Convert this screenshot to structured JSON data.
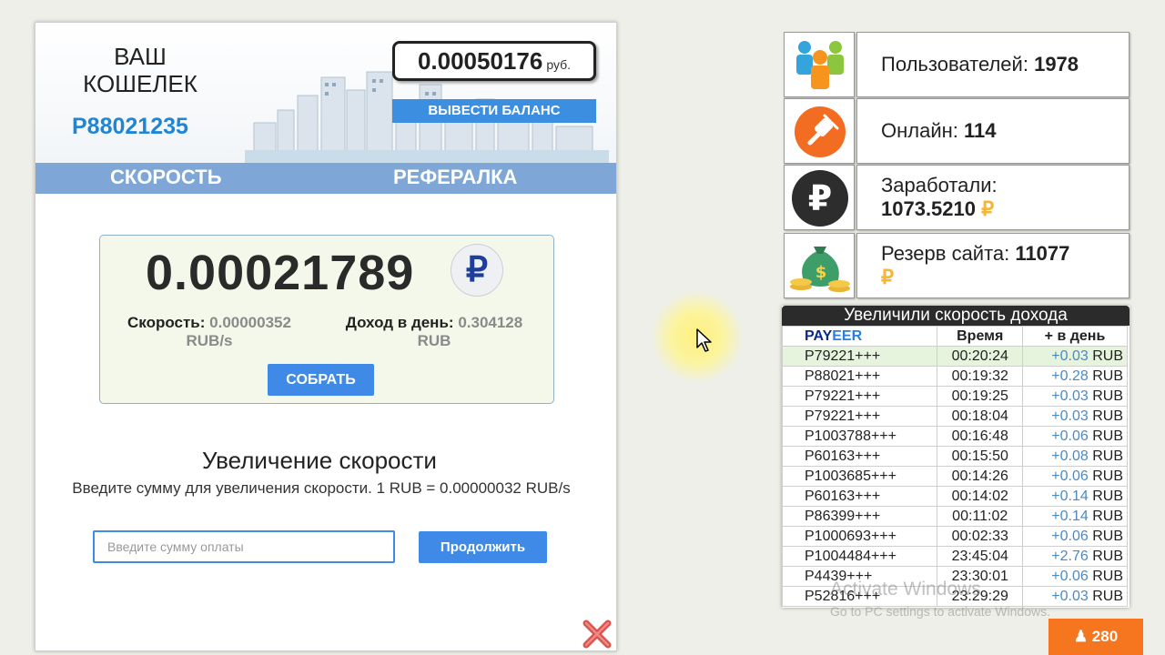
{
  "wallet": {
    "title": "ВАШ КОШЕЛЕК",
    "id": "P88021235",
    "balance": "0.00050176",
    "balance_unit": "руб.",
    "withdraw_label": "ВЫВЕСТИ БАЛАНС"
  },
  "nav": {
    "speed": "СКОРОСТЬ",
    "referral": "РЕФЕРАЛКА"
  },
  "mining": {
    "value": "0.00021789",
    "currency_symbol": "₽",
    "speed_label": "Скорость:",
    "speed_value": "0.00000352",
    "speed_unit": "RUB/s",
    "daily_label": "Доход в день:",
    "daily_value": "0.304128",
    "daily_unit": "RUB",
    "collect_label": "СОБРАТЬ"
  },
  "increase": {
    "title": "Увеличение скорости",
    "description": "Введите сумму для увеличения скорости. 1 RUB = 0.00000032 RUB/s",
    "input_placeholder": "Введите сумму оплаты",
    "continue_label": "Продолжить"
  },
  "stats": {
    "users_label": "Пользователей:",
    "users_value": "1978",
    "online_label": "Онлайн:",
    "online_value": "114",
    "earned_label": "Заработали:",
    "earned_value": "1073.5210",
    "reserve_label": "Резерв сайта:",
    "reserve_value": "11077",
    "rub_symbol": "₽"
  },
  "log": {
    "title": "Увеличили скорость дохода",
    "columns": {
      "payeer_a": "PAY",
      "payeer_b": "EER",
      "time": "Время",
      "daily": "+ в день"
    },
    "rows": [
      {
        "account": "P79221+++",
        "time": "00:20:24",
        "amount": "+0.03",
        "unit": "RUB"
      },
      {
        "account": "P88021+++",
        "time": "00:19:32",
        "amount": "+0.28",
        "unit": "RUB"
      },
      {
        "account": "P79221+++",
        "time": "00:19:25",
        "amount": "+0.03",
        "unit": "RUB"
      },
      {
        "account": "P79221+++",
        "time": "00:18:04",
        "amount": "+0.03",
        "unit": "RUB"
      },
      {
        "account": "P1003788+++",
        "time": "00:16:48",
        "amount": "+0.06",
        "unit": "RUB"
      },
      {
        "account": "P60163+++",
        "time": "00:15:50",
        "amount": "+0.08",
        "unit": "RUB"
      },
      {
        "account": "P1003685+++",
        "time": "00:14:26",
        "amount": "+0.06",
        "unit": "RUB"
      },
      {
        "account": "P60163+++",
        "time": "00:14:02",
        "amount": "+0.14",
        "unit": "RUB"
      },
      {
        "account": "P86399+++",
        "time": "00:11:02",
        "amount": "+0.14",
        "unit": "RUB"
      },
      {
        "account": "P1000693+++",
        "time": "00:02:33",
        "amount": "+0.06",
        "unit": "RUB"
      },
      {
        "account": "P1004484+++",
        "time": "23:45:04",
        "amount": "+2.76",
        "unit": "RUB"
      },
      {
        "account": "P4439+++",
        "time": "23:30:01",
        "amount": "+0.06",
        "unit": "RUB"
      },
      {
        "account": "P52816+++",
        "time": "23:29:29",
        "amount": "+0.03",
        "unit": "RUB"
      }
    ]
  },
  "watermark": {
    "line1": "Activate Windows",
    "line2": "Go to PC settings to activate Windows."
  },
  "counter": {
    "icon": "user-icon",
    "value": "280"
  },
  "colors": {
    "accent_blue": "#3e8ae6",
    "nav_blue": "#7ea6d6",
    "orange": "#f5761e",
    "rub_gold": "#f6b535"
  }
}
